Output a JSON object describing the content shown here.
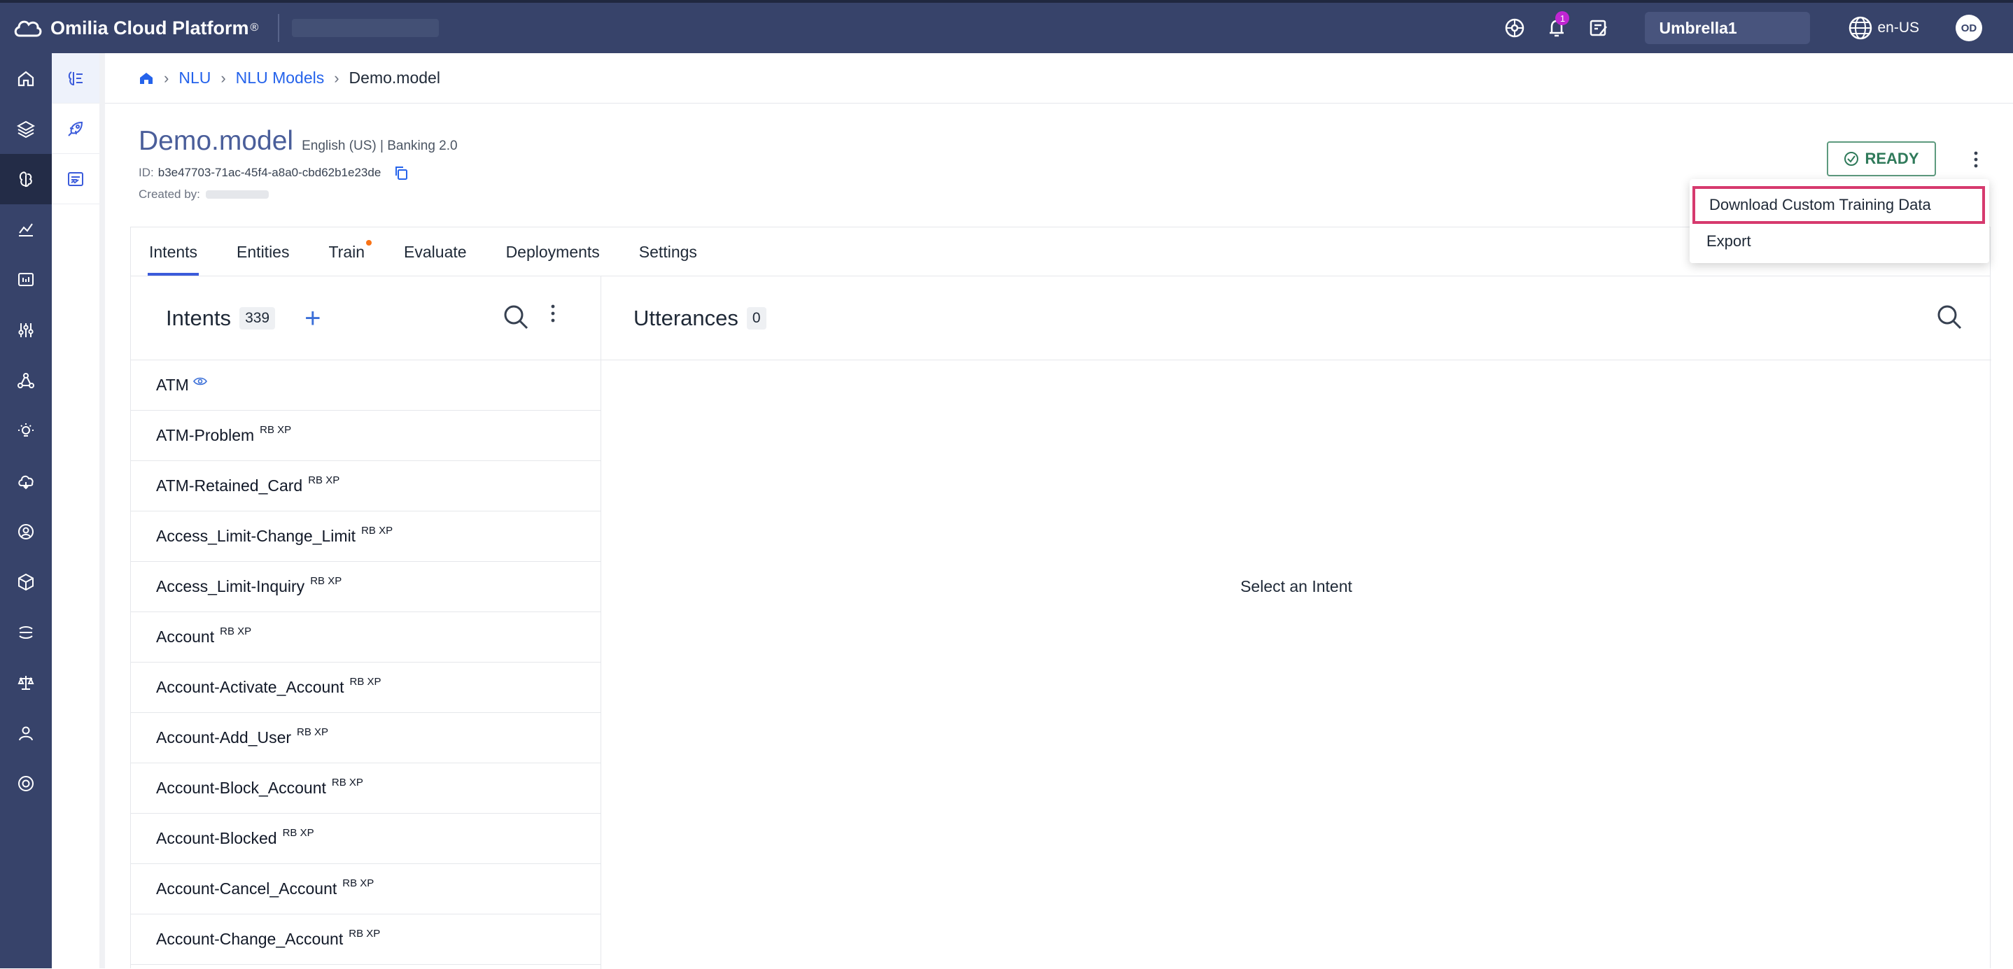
{
  "topbar": {
    "app_name": "Omilia Cloud Platform",
    "reg_mark": "®",
    "notification_count": "1",
    "tenant": "Umbrella1",
    "language": "en-US",
    "avatar_initials": "OD"
  },
  "breadcrumb": {
    "items": [
      "NLU",
      "NLU Models"
    ],
    "current": "Demo.model"
  },
  "model": {
    "title": "Demo.model",
    "subtitle": "English (US) | Banking 2.0",
    "id_label": "ID:",
    "id": "b3e47703-71ac-45f4-a8a0-cbd62b1e23de",
    "created_label": "Created by:",
    "status": "READY"
  },
  "menu": {
    "items": [
      "Download Custom Training Data",
      "Export"
    ]
  },
  "tabs": [
    "Intents",
    "Entities",
    "Train",
    "Evaluate",
    "Deployments",
    "Settings"
  ],
  "intents": {
    "title": "Intents",
    "count": "339",
    "plus": "+",
    "tag": "RB XP",
    "items": [
      "ATM",
      "ATM-Problem",
      "ATM-Retained_Card",
      "Access_Limit-Change_Limit",
      "Access_Limit-Inquiry",
      "Account",
      "Account-Activate_Account",
      "Account-Add_User",
      "Account-Block_Account",
      "Account-Blocked",
      "Account-Cancel_Account",
      "Account-Change_Account"
    ]
  },
  "utterances": {
    "title": "Utterances",
    "count": "0",
    "empty_message": "Select an Intent"
  },
  "colors": {
    "nav_bg": "#37436a",
    "accent": "#3b5bdb",
    "ready": "#2f7a5a",
    "highlight": "#d63a6e"
  }
}
